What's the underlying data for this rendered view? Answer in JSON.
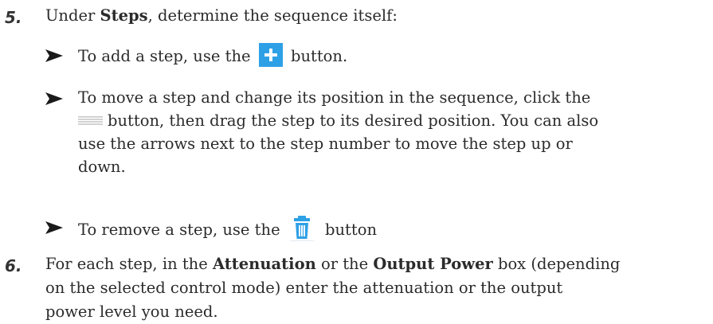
{
  "step5": {
    "number": "5.",
    "text_before": "Under ",
    "bold": "Steps",
    "text_after": ", determine the sequence itself:"
  },
  "bullets": {
    "add": {
      "before": "To add a step, use the",
      "after": "button.",
      "icon": "plus-icon"
    },
    "move": {
      "line1": "To move a step and change its position in the sequence, click the",
      "line2_after": "button, then drag the step to its desired position. You can also",
      "line3": "use the arrows next to the step number to move the step up or",
      "line4": "down.",
      "icon": "drag-handle-icon"
    },
    "remove": {
      "before": "To remove a step, use the",
      "after": "button",
      "icon": "trash-icon"
    }
  },
  "step6": {
    "number": "6.",
    "t1": "For each step, in the ",
    "b1": "Attenuation",
    "t2": " or the ",
    "b2": "Output Power",
    "t3": " box (depending",
    "line2": "on the selected control mode) enter the attenuation or the output",
    "line3": "power level you need."
  },
  "colors": {
    "text": "#2b2b2b",
    "icon_blue": "#2ea0e6",
    "handle_gray": "#c8c8c8"
  }
}
